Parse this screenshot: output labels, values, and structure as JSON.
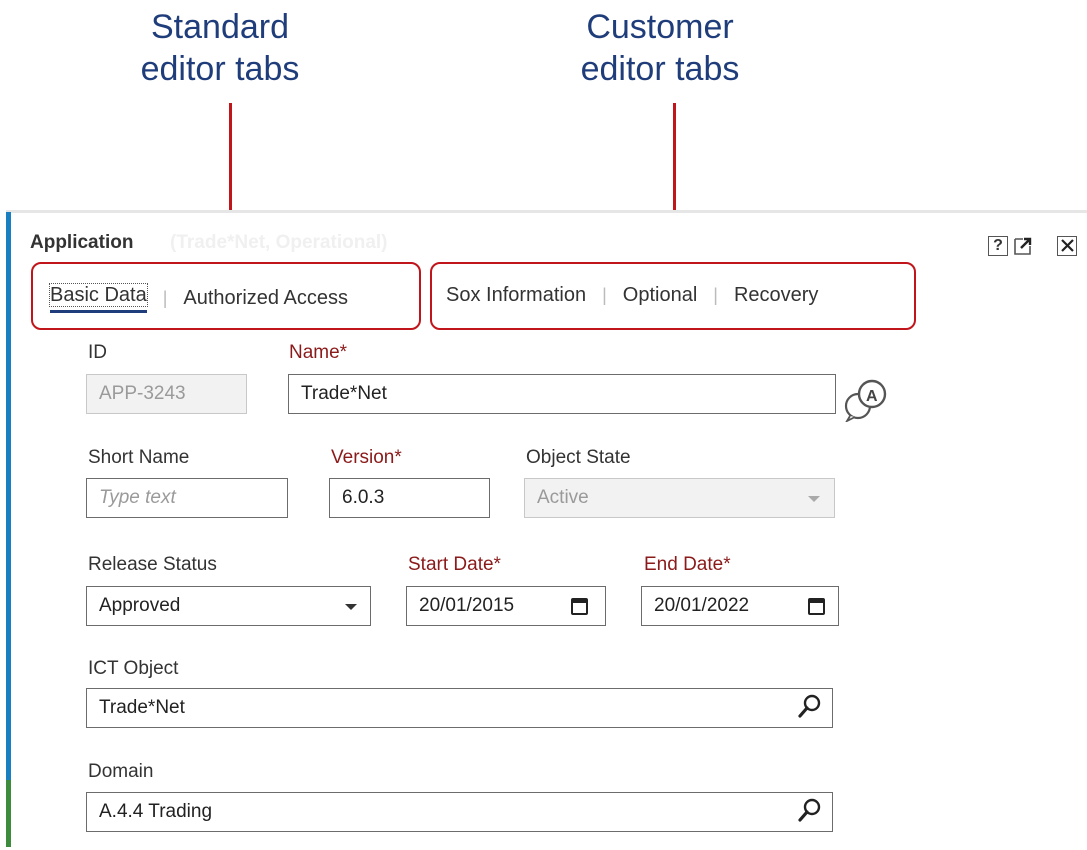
{
  "callouts": {
    "standard_line1": "Standard",
    "standard_line2": "editor tabs",
    "customer_line1": "Customer",
    "customer_line2": "editor tabs"
  },
  "panel": {
    "title": "Application",
    "ghost_title": "(Trade*Net, Operational)",
    "icons": [
      "help-icon",
      "popout-icon",
      "close-icon"
    ],
    "help_label": "?"
  },
  "tabs": {
    "standard": [
      "Basic Data",
      "Authorized Access"
    ],
    "customer": [
      "Sox Information",
      "Optional",
      "Recovery"
    ],
    "active": "Basic Data"
  },
  "form": {
    "id": {
      "label": "ID",
      "value": "APP-3243"
    },
    "name": {
      "label": "Name*",
      "value": "Trade*Net"
    },
    "short_name": {
      "label": "Short Name",
      "placeholder": "Type text"
    },
    "version": {
      "label": "Version*",
      "value": "6.0.3"
    },
    "object_state": {
      "label": "Object State",
      "value": "Active"
    },
    "release_status": {
      "label": "Release Status",
      "value": "Approved"
    },
    "start_date": {
      "label": "Start Date*",
      "value": "20/01/2015"
    },
    "end_date": {
      "label": "End Date*",
      "value": "20/01/2022"
    },
    "ict_object": {
      "label": "ICT Object",
      "value": "Trade*Net"
    },
    "domain": {
      "label": "Domain",
      "value": "A.4.4 Trading"
    }
  },
  "colors": {
    "callout_text": "#1f3d7a",
    "highlight_red": "#c0161b",
    "required_label": "#8b1a1a",
    "accent_bar": "#1a7fc1"
  }
}
